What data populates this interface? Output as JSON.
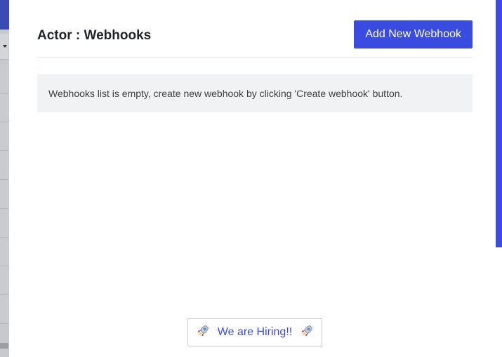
{
  "drawer": {
    "title": "Actor : Webhooks",
    "add_button_label": "Add New Webhook",
    "empty_message": "Webhooks list is empty, create new webhook by clicking 'Create webhook' button."
  },
  "footer": {
    "hiring_label": "We are Hiring!!",
    "hiring_icon": "rocket-icon"
  },
  "colors": {
    "accent": "#3a4be0",
    "top_bar": "#3c4bb3",
    "alert_bg": "#f1f2f4"
  }
}
